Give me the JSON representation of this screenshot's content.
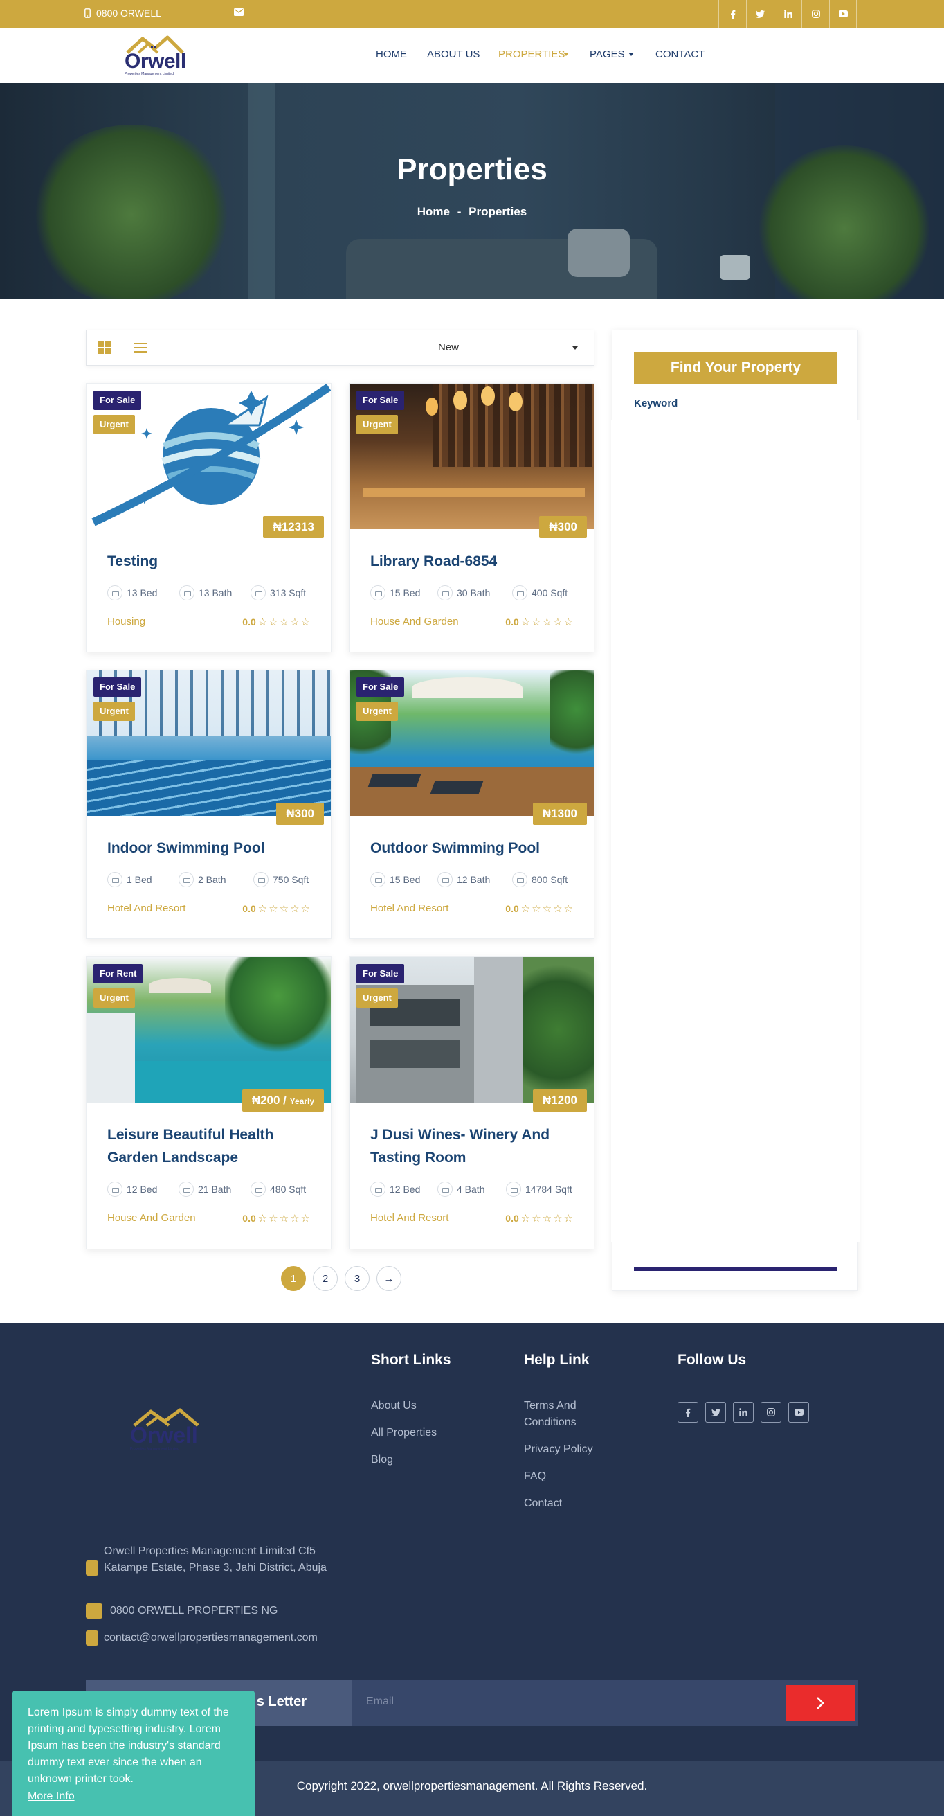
{
  "topbar": {
    "phone": "0800 ORWELL"
  },
  "brand": {
    "logo_text": "Orwell",
    "tagline": "Properties Management Limited"
  },
  "nav": {
    "items": [
      {
        "label": "HOME"
      },
      {
        "label": "ABOUT US"
      },
      {
        "label": "PROPERTIES"
      },
      {
        "label": "PAGES"
      },
      {
        "label": "CONTACT"
      }
    ]
  },
  "hero": {
    "title": "Properties",
    "breadcrumb_home": "Home",
    "breadcrumb_sep": "-",
    "breadcrumb_current": "Properties"
  },
  "toolbar": {
    "sort_value": "New"
  },
  "listings": [
    {
      "sale": "For Sale",
      "tag": "Urgent",
      "price": "₦12313",
      "title": "Testing",
      "bed": "13 Bed",
      "bath": "13 Bath",
      "area": "313 Sqft",
      "category": "Housing",
      "rating": "0.0"
    },
    {
      "sale": "For Sale",
      "tag": "Urgent",
      "price": "₦300",
      "title": "Library Road-6854",
      "bed": "15 Bed",
      "bath": "30 Bath",
      "area": "400 Sqft",
      "category": "House And Garden",
      "rating": "0.0"
    },
    {
      "sale": "For Sale",
      "tag": "Urgent",
      "price": "₦300",
      "title": "Indoor Swimming Pool",
      "bed": "1 Bed",
      "bath": "2 Bath",
      "area": "750 Sqft",
      "category": "Hotel And Resort",
      "rating": "0.0"
    },
    {
      "sale": "For Sale",
      "tag": "Urgent",
      "price": "₦1300",
      "title": "Outdoor Swimming Pool",
      "bed": "15 Bed",
      "bath": "12 Bath",
      "area": "800 Sqft",
      "category": "Hotel And Resort",
      "rating": "0.0"
    },
    {
      "sale": "For Rent",
      "tag": "Urgent",
      "price": "₦200 / ",
      "price_period": "Yearly",
      "title": "Leisure Beautiful Health Garden Landscape",
      "bed": "12 Bed",
      "bath": "21 Bath",
      "area": "480 Sqft",
      "category": "House And Garden",
      "rating": "0.0"
    },
    {
      "sale": "For Sale",
      "tag": "Urgent",
      "price": "₦1200",
      "title": "J Dusi Wines- Winery And Tasting Room",
      "bed": "12 Bed",
      "bath": "4 Bath",
      "area": "14784 Sqft",
      "category": "Hotel And Resort",
      "rating": "0.0"
    }
  ],
  "pagination": {
    "pages": [
      "1",
      "2",
      "3"
    ],
    "next": "→"
  },
  "sidebar": {
    "find_button": "Find Your Property",
    "keyword_label": "Keyword"
  },
  "footer": {
    "short_links_title": "Short Links",
    "short_links": [
      "About Us",
      "All Properties",
      "Blog"
    ],
    "help_title": "Help Link",
    "help_links": [
      "Terms And Conditions",
      "Privacy Policy",
      "FAQ",
      "Contact"
    ],
    "follow_title": "Follow Us",
    "address": "Orwell Properties Management Limited Cf5 Katampe Estate, Phase 3, Jahi District, Abuja",
    "phone": "0800 ORWELL PROPERTIES NG",
    "email": "contact@orwellpropertiesmanagement.com",
    "newsletter_label": "s Letter",
    "email_placeholder": "Email",
    "copyright": "Copyright 2022, orwellpropertiesmanagement. All Rights Reserved."
  },
  "cookie": {
    "text": "Lorem Ipsum is simply dummy text of the printing and typesetting industry. Lorem Ipsum has been the industry's standard dummy text ever since the when an unknown printer took.",
    "link": "More Info"
  },
  "colors": {
    "gold": "#cda83f",
    "navy": "#2a2370",
    "footer_bg": "#24324d",
    "teal": "#47c1b0",
    "red": "#ea2c2c"
  },
  "icons": [
    "phone-icon",
    "mail-icon",
    "facebook-icon",
    "twitter-icon",
    "linkedin-icon",
    "instagram-icon",
    "youtube-icon",
    "grid-view-icon",
    "list-view-icon",
    "bed-icon",
    "bath-icon",
    "area-icon",
    "star-icon",
    "chevron-right-icon"
  ]
}
